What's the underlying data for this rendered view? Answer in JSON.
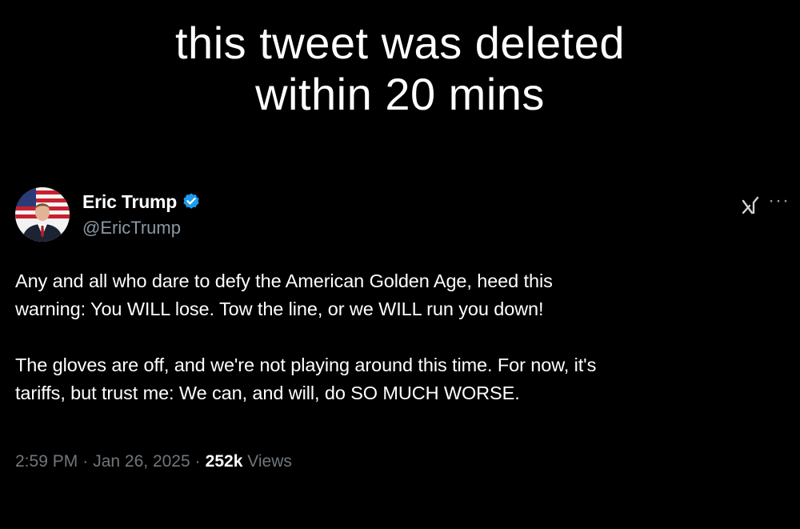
{
  "caption": {
    "line1": "this tweet was deleted",
    "line2": "within 20 mins"
  },
  "tweet": {
    "author": {
      "display_name": "Eric Trump",
      "handle": "@EricTrump",
      "verified": true
    },
    "paragraphs": [
      {
        "lines": [
          "Any and all who dare to defy the American Golden Age, heed this",
          "warning: You WILL lose. Tow the line, or we WILL run you down!"
        ]
      },
      {
        "lines": [
          "The gloves are off, and we're not playing around this time. For now, it's",
          "tariffs, but trust me: We can, and will, do SO MUCH WORSE."
        ]
      }
    ],
    "time": "2:59 PM",
    "date": "Jan 26, 2025",
    "separator": "·",
    "views_count": "252k",
    "views_label": "Views",
    "more_label": "···"
  },
  "icons": {
    "verified": "verified-badge-icon",
    "grok": "grok-icon",
    "more": "more-options-icon"
  },
  "colors": {
    "background": "#000000",
    "text_primary": "#ffffff",
    "text_secondary": "#71767b",
    "verified_blue": "#1d9bf0"
  }
}
